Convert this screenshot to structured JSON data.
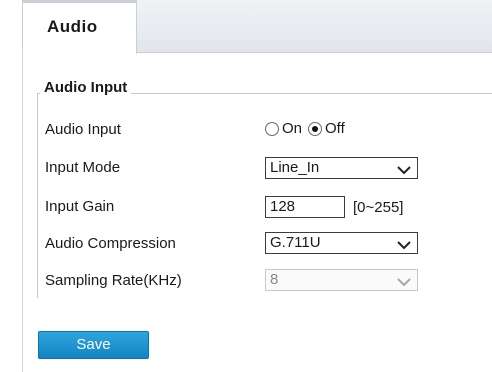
{
  "tabs": [
    {
      "label": "Audio",
      "active": true
    }
  ],
  "section": {
    "title": "Audio Input"
  },
  "fields": {
    "audio_input": {
      "label": "Audio Input",
      "options": [
        "On",
        "Off"
      ],
      "selected": "Off"
    },
    "input_mode": {
      "label": "Input Mode",
      "value": "Line_In"
    },
    "input_gain": {
      "label": "Input Gain",
      "value": "128",
      "range_hint": "[0~255]"
    },
    "audio_compression": {
      "label": "Audio Compression",
      "value": "G.711U"
    },
    "sampling_rate": {
      "label": "Sampling Rate(KHz)",
      "value": "8",
      "disabled": true
    }
  },
  "actions": {
    "save_label": "Save"
  },
  "colors": {
    "accent": "#1a8fcc",
    "tab_bar": "#e6e9ed"
  }
}
